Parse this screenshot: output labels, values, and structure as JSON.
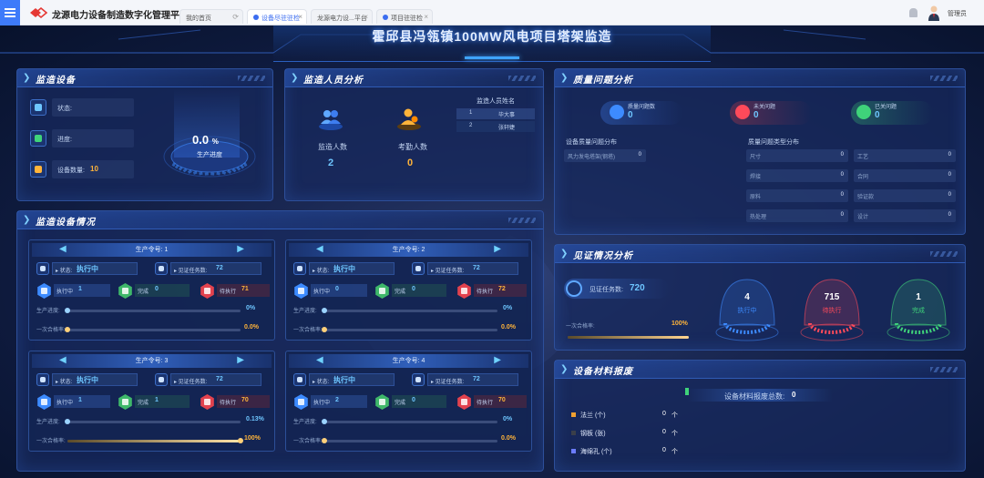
{
  "app": {
    "title": "龙源电力设备制造数字化管理平台"
  },
  "tabs": [
    {
      "label": "我的首页",
      "active": false
    },
    {
      "label": "设备尽驻驻检",
      "active": true
    },
    {
      "label": "龙源电力设...平台",
      "active": false
    },
    {
      "label": "项目驻驻检",
      "active": false
    }
  ],
  "user": {
    "name": "管理员"
  },
  "dashboard": {
    "title": "霍邱县冯瓴镇100MW风电项目塔架监造"
  },
  "monitor_equipment": {
    "title": "监造设备",
    "status_label": "状态:",
    "status_value": "",
    "progress_label": "进度:",
    "progress_value": "",
    "count_label": "设备数量:",
    "count_value": "10",
    "gauge_value": "0.0",
    "gauge_unit": "%",
    "gauge_label": "生产进度",
    "gauge_fraction": 0.0
  },
  "personnel": {
    "title": "监造人员分析",
    "supervisor_label": "监造人数",
    "supervisor_value": "2",
    "attendance_label": "考勤人数",
    "attendance_value": "0",
    "names_title": "监造人员姓名",
    "names": [
      {
        "no": "1",
        "name": "毕大事"
      },
      {
        "no": "2",
        "name": "张轩婕"
      }
    ]
  },
  "quality": {
    "title": "质量问题分析",
    "total_label": "质量问题数",
    "total_value": "0",
    "unclosed_label": "未关问题",
    "unclosed_value": "0",
    "closed_label": "已关问题",
    "closed_value": "0",
    "dist_title": "设备质量问题分布",
    "dist_rows": [
      {
        "k": "风力发电塔架(钢塔)",
        "v": "0"
      }
    ],
    "type_title": "质量问题类型分布",
    "type_rows": [
      {
        "k": "尺寸",
        "v": "0"
      },
      {
        "k": "工艺",
        "v": "0"
      },
      {
        "k": "焊接",
        "v": "0"
      },
      {
        "k": "合同",
        "v": "0"
      },
      {
        "k": "原料",
        "v": "0"
      },
      {
        "k": "验证款",
        "v": "0"
      },
      {
        "k": "热处理",
        "v": "0"
      },
      {
        "k": "设计",
        "v": "0"
      }
    ]
  },
  "equipment_status": {
    "title": "监造设备情况",
    "cards": [
      {
        "order_label": "生产令号: 1",
        "status_label": "▸ 状态:",
        "status_value": "执行中",
        "tasks_label": "▸ 见证任务数:",
        "tasks_value": "72",
        "executing_label": "执行中",
        "executing_value": "1",
        "done_label": "完成",
        "done_value": "0",
        "pending_label": "待执行",
        "pending_value": "71",
        "prog_label": "生产进度:",
        "prog_value": "0%",
        "prog_fraction": 0.0,
        "pass_label": "一次合格率:",
        "pass_value": "0.0%",
        "pass_fraction": 0.0
      },
      {
        "order_label": "生产令号: 2",
        "status_label": "▸ 状态:",
        "status_value": "执行中",
        "tasks_label": "▸ 见证任务数:",
        "tasks_value": "72",
        "executing_label": "执行中",
        "executing_value": "0",
        "done_label": "完成",
        "done_value": "0",
        "pending_label": "待执行",
        "pending_value": "72",
        "prog_label": "生产进度:",
        "prog_value": "0%",
        "prog_fraction": 0.0,
        "pass_label": "一次合格率:",
        "pass_value": "0.0%",
        "pass_fraction": 0.0
      },
      {
        "order_label": "生产令号: 3",
        "status_label": "▸ 状态:",
        "status_value": "执行中",
        "tasks_label": "▸ 见证任务数:",
        "tasks_value": "72",
        "executing_label": "执行中",
        "executing_value": "1",
        "done_label": "完成",
        "done_value": "1",
        "pending_label": "待执行",
        "pending_value": "70",
        "prog_label": "生产进度:",
        "prog_value": "0.13%",
        "prog_fraction": 0.0013,
        "pass_label": "一次合格率:",
        "pass_value": "100%",
        "pass_fraction": 1.0
      },
      {
        "order_label": "生产令号: 4",
        "status_label": "▸ 状态:",
        "status_value": "执行中",
        "tasks_label": "▸ 见证任务数:",
        "tasks_value": "72",
        "executing_label": "执行中",
        "executing_value": "2",
        "done_label": "完成",
        "done_value": "0",
        "pending_label": "待执行",
        "pending_value": "70",
        "prog_label": "生产进度:",
        "prog_value": "0%",
        "prog_fraction": 0.0,
        "pass_label": "一次合格率:",
        "pass_value": "0.0%",
        "pass_fraction": 0.0
      }
    ]
  },
  "witness": {
    "title": "见证情况分析",
    "tasks_label": "见证任务数:",
    "tasks_value": "720",
    "pass_label": "一次合格率:",
    "pass_value": "100%",
    "pass_fraction": 1.0,
    "executing_value": "4",
    "executing_label": "执行中",
    "pending_value": "715",
    "pending_label": "待执行",
    "done_value": "1",
    "done_label": "完成"
  },
  "materials": {
    "title": "设备材料报废",
    "total_label": "设备材料报废总数:",
    "total_value": "0",
    "items": [
      {
        "name": "法兰 (个)",
        "value": "0",
        "unit": "个",
        "color": "#f0a030"
      },
      {
        "name": "钢板 (张)",
        "value": "0",
        "unit": "个",
        "color": "#3a3f4a"
      },
      {
        "name": "海绵孔 (个)",
        "value": "0",
        "unit": "个",
        "color": "#6b7cff"
      }
    ]
  },
  "colors": {
    "accent": "#3fa4ff",
    "blue": "#3d8bff",
    "green": "#3fd37a",
    "red": "#ff4a5a",
    "orange": "#ffb43a"
  }
}
